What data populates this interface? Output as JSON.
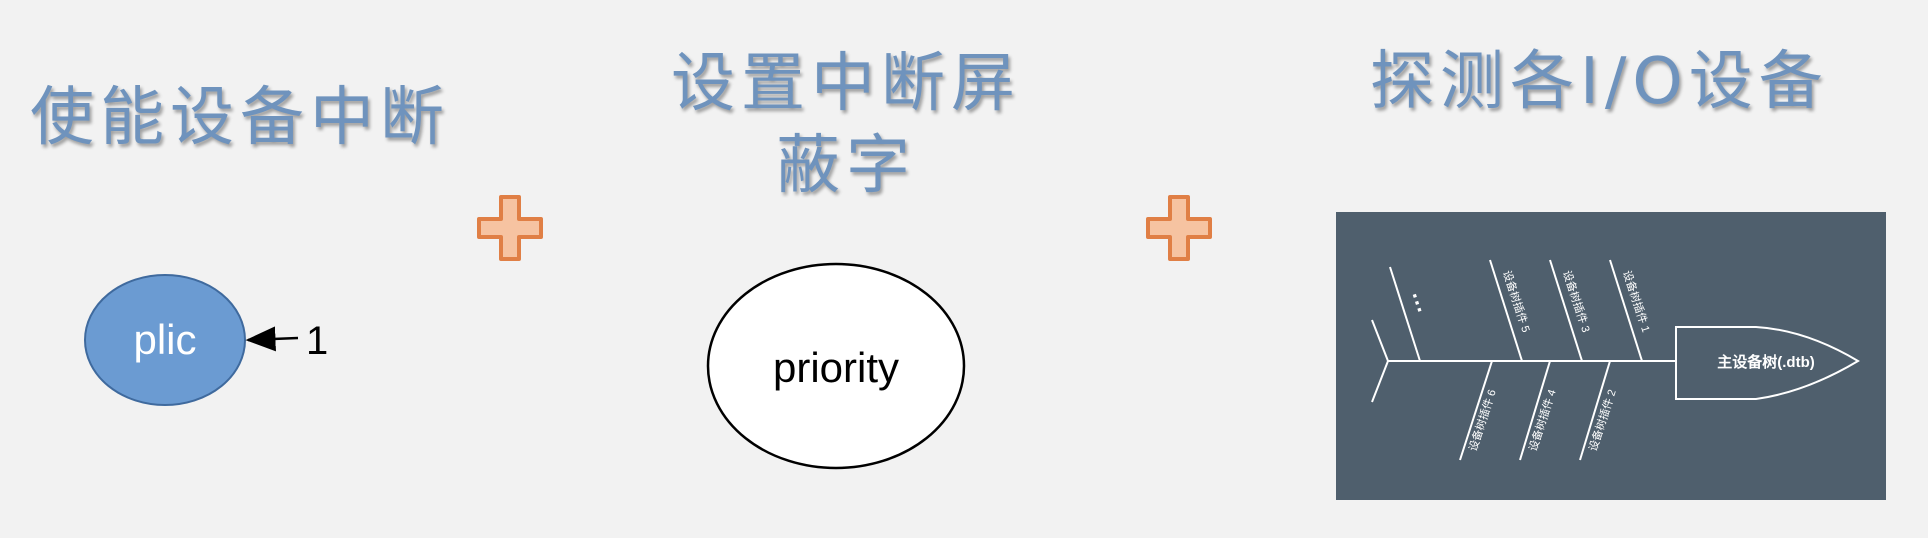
{
  "titles": {
    "enable_interrupt": "使能设备中断",
    "set_mask": "设置中断屏蔽字",
    "probe_io": "探测各I/O设备"
  },
  "plic": {
    "label": "plic",
    "value": "1"
  },
  "priority": {
    "label": "priority"
  },
  "fishbone": {
    "head": "主设备树(.dtb)",
    "ellipsis": "···",
    "bones_top": [
      "设备树插件 5",
      "设备树插件 3",
      "设备树插件 1"
    ],
    "bones_bottom": [
      "设备树插件 6",
      "设备树插件 4",
      "设备树插件 2"
    ]
  },
  "colors": {
    "title": "#6f93bd",
    "plic_fill": "#6b9bd2",
    "plus_fill": "#f6c3a1",
    "plus_stroke": "#e07f45",
    "fishbone_bg": "#4f5f6d"
  }
}
